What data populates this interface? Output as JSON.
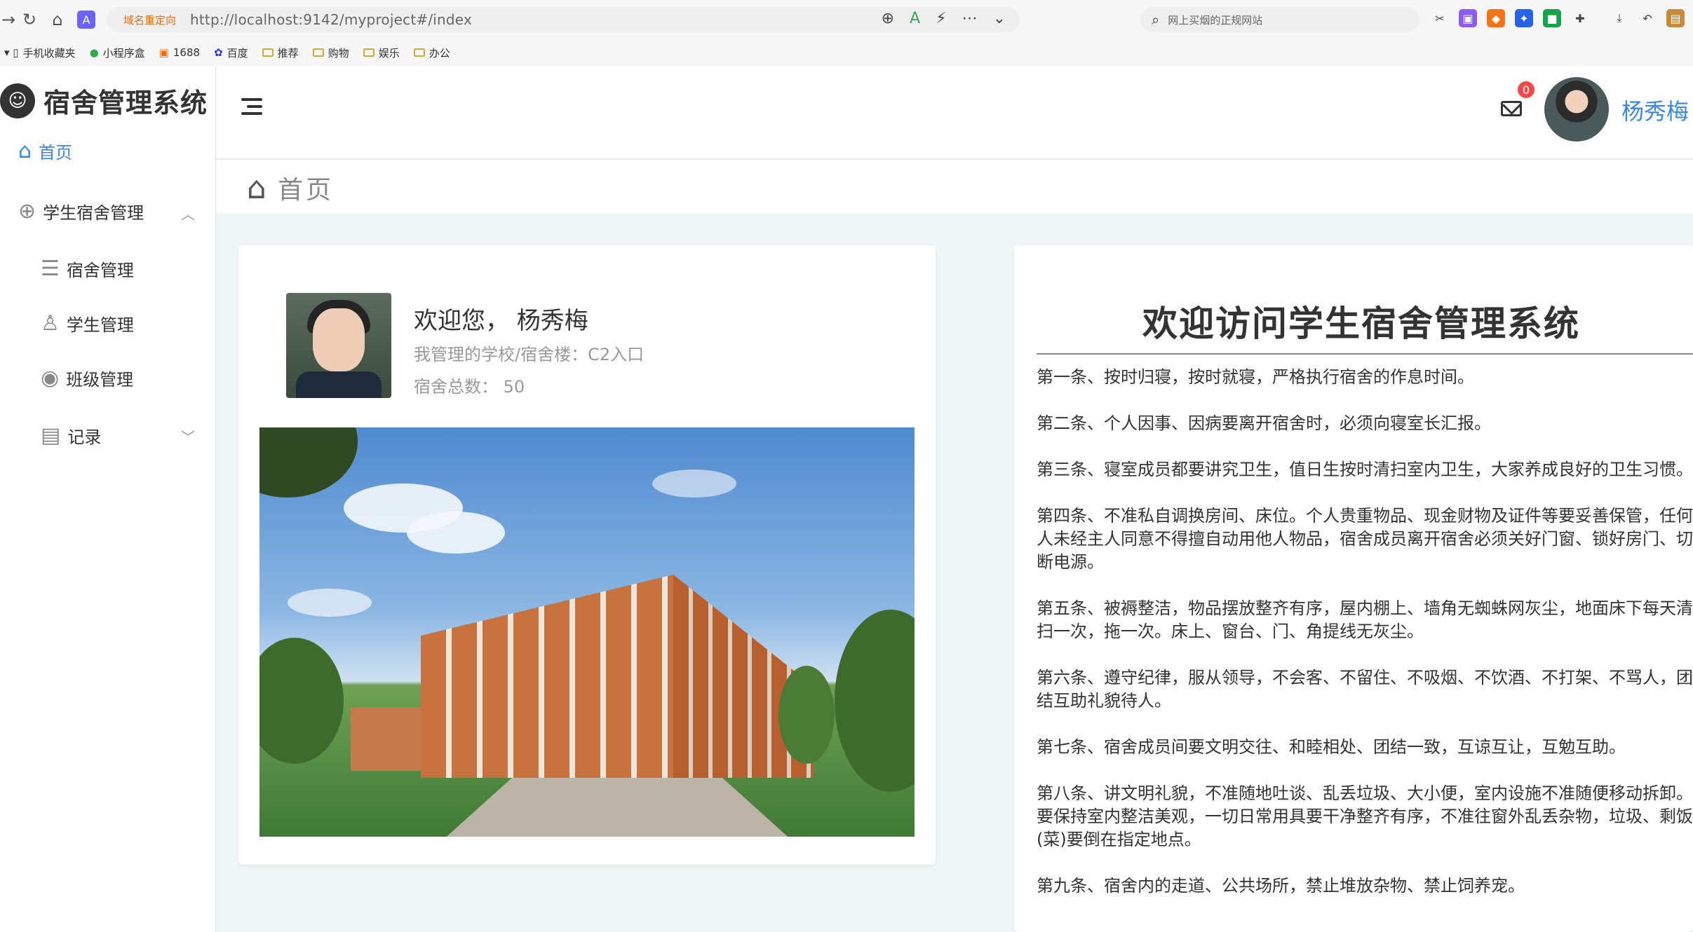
{
  "browser": {
    "address_tag": "域名重定向",
    "url": "http://localhost:9142/myproject#/index",
    "search_placeholder": "网上买烟的正规网站",
    "bookmarks": [
      "手机收藏夹",
      "小程序盒",
      "1688",
      "百度",
      "推荐",
      "购物",
      "娱乐",
      "办公"
    ]
  },
  "sidebar": {
    "logo_text": "宿舍管理系统",
    "items": [
      {
        "label": "首页",
        "icon": "home-icon"
      },
      {
        "label": "学生宿舍管理",
        "icon": "plus-circle-icon"
      },
      {
        "label": "宿舍管理",
        "icon": "list-icon"
      },
      {
        "label": "学生管理",
        "icon": "user-icon"
      },
      {
        "label": "班级管理",
        "icon": "drop-icon"
      },
      {
        "label": "记录",
        "icon": "document-icon"
      }
    ]
  },
  "header": {
    "notification_count": "0",
    "user_name": "杨秀梅"
  },
  "page": {
    "title": "首页"
  },
  "profile_card": {
    "welcome": "欢迎您， 杨秀梅",
    "school_line": "我管理的学校/宿舍楼：C2入口",
    "dorm_count_line": "宿舍总数：  50"
  },
  "rules": {
    "title": "欢迎访问学生宿舍管理系统",
    "items": [
      "第一条、按时归寝，按时就寝，严格执行宿舍的作息时间。",
      "第二条、个人因事、因病要离开宿舍时，必须向寝室长汇报。",
      "第三条、寝室成员都要讲究卫生，值日生按时清扫室内卫生，大家养成良好的卫生习惯。",
      "第四条、不准私自调换房间、床位。个人贵重物品、现金财物及证件等要妥善保管，任何人未经主人同意不得擅自动用他人物品，宿舍成员离开宿舍必须关好门窗、锁好房门、切断电源。",
      "第五条、被褥整洁，物品摆放整齐有序，屋内棚上、墙角无蜘蛛网灰尘，地面床下每天清扫一次，拖一次。床上、窗台、门、角提线无灰尘。",
      "第六条、遵守纪律，服从领导，不会客、不留住、不吸烟、不饮酒、不打架、不骂人，团结互助礼貌待人。",
      "第七条、宿舍成员间要文明交往、和睦相处、团结一致，互谅互让，互勉互助。",
      "第八条、讲文明礼貌，不准随地吐谈、乱丢垃圾、大小便，室内设施不准随便移动拆卸。要保持室内整洁美观，一切日常用具要干净整齐有序，不准往窗外乱丢杂物，垃圾、剩饭(菜)要倒在指定地点。",
      "第九条、宿舍内的走道、公共场所，禁止堆放杂物、禁止饲养宠。"
    ]
  },
  "colors": {
    "accent": "#3b87e6",
    "badge": "#f04a4a",
    "content_bg": "#eef6f7"
  }
}
